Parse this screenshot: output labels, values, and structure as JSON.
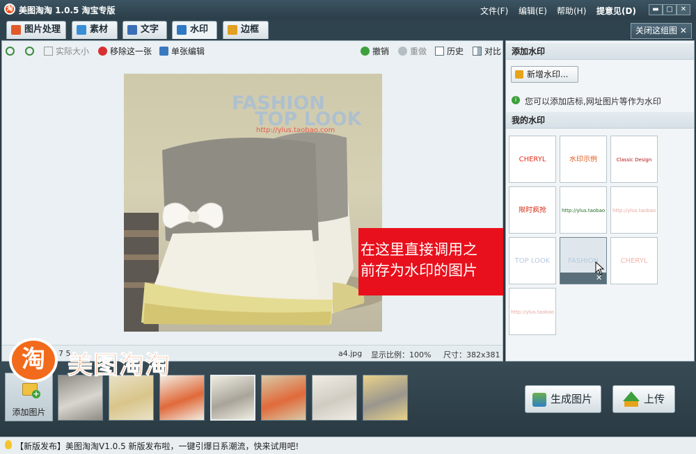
{
  "window": {
    "logo_glyph": "淘",
    "title": "美图淘淘 1.0.5 淘宝专版",
    "menu": [
      "文件(F)",
      "编辑(E)",
      "帮助(H)",
      "提意见(D)"
    ],
    "controls": {
      "minimize": "▬",
      "maximize": "□",
      "close": "✕"
    }
  },
  "tabs": [
    {
      "label": "图片处理",
      "icon": "palette-icon",
      "color": "#e05a2a"
    },
    {
      "label": "素材",
      "icon": "image-icon",
      "color": "#3a8fd4"
    },
    {
      "label": "文字",
      "icon": "text-a-icon",
      "color": "#3a6fb8"
    },
    {
      "label": "水印",
      "icon": "watermark-icon",
      "color": "#2f78c4",
      "active": true
    },
    {
      "label": "边框",
      "icon": "frame-icon",
      "color": "#e0a020"
    }
  ],
  "close_group": {
    "label": "关闭这组图",
    "icon": "✕"
  },
  "toolbar": {
    "actual_size": "实际大小",
    "remove": "移除这一张",
    "edit_single": "单张编辑",
    "undo": "撤销",
    "redo": "重做",
    "history": "历史",
    "compare": "对比"
  },
  "canvas": {
    "watermark_line1": "FASHION",
    "watermark_line2": "TOP LOOK",
    "watermark_url": "http://ylus.taobao.com"
  },
  "callout": {
    "line1": "在这里直接调用之",
    "line2": "前存为水印的图片"
  },
  "status": {
    "count_prefix": "7 5",
    "file": "a4.jpg",
    "ratio_label": "显示比例：100%",
    "size_label": "尺寸：382x381"
  },
  "right_panel": {
    "add_header": "添加水印",
    "add_button": "新增水印...",
    "info": "您可以添加店标,网址图片等作为水印",
    "my_header": "我的水印",
    "watermarks": [
      {
        "text": "CHERYL",
        "color": "#e0301e"
      },
      {
        "text": "水印示例",
        "color": "#e05a1a"
      },
      {
        "text": "Classic Design",
        "color": "#b81414"
      },
      {
        "text": "限时疯抢",
        "color": "#d42a12"
      },
      {
        "text": "http://ylus.taobao.com",
        "color": "#1f6b1f"
      },
      {
        "text": "http://ylus.taobao.com",
        "color": "#e4a8a0"
      },
      {
        "text": "TOP LOOK",
        "color": "#b5c9de"
      },
      {
        "text": "FASHION",
        "color": "#b5c9de"
      },
      {
        "text": "CHERYL",
        "color": "#f0b4aa"
      },
      {
        "text": "http://ylus.taobao.com",
        "color": "#e4a8a0"
      }
    ]
  },
  "strip": {
    "add_image": "添加图片",
    "thumbnails": 7,
    "selected_thumbnail": 4,
    "generate": "生成图片",
    "upload": "上传"
  },
  "brand": {
    "glyph": "淘",
    "text": "美图淘淘"
  },
  "news": "【新版发布】美图淘淘V1.0.5 新版发布啦，一键引爆日系潮流，快来试用吧!",
  "colors": {
    "accent_red": "#e8101c",
    "brand_orange": "#f4711f",
    "chrome": "#2c3b44"
  }
}
